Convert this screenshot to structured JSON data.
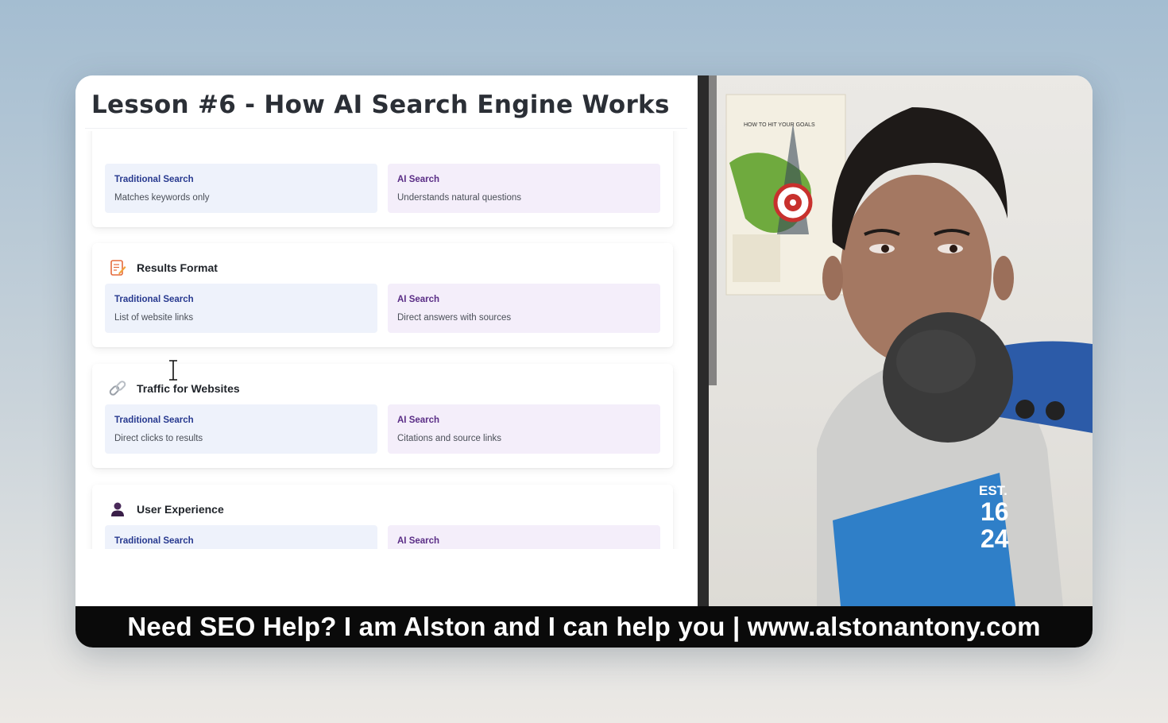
{
  "lesson": {
    "title": "Lesson #6 - How AI Search Engine Works"
  },
  "comparisons": [
    {
      "title": "",
      "icon": "none",
      "traditional": {
        "label": "Traditional Search",
        "desc": "Matches keywords only"
      },
      "ai": {
        "label": "AI Search",
        "desc": "Understands natural questions"
      }
    },
    {
      "title": "Results Format",
      "icon": "memo-icon",
      "traditional": {
        "label": "Traditional Search",
        "desc": "List of website links"
      },
      "ai": {
        "label": "AI Search",
        "desc": "Direct answers with sources"
      }
    },
    {
      "title": "Traffic for Websites",
      "icon": "link-icon",
      "traditional": {
        "label": "Traditional Search",
        "desc": "Direct clicks to results"
      },
      "ai": {
        "label": "AI Search",
        "desc": "Citations and source links"
      }
    },
    {
      "title": "User Experience",
      "icon": "user-icon",
      "traditional": {
        "label": "Traditional Search",
        "desc": ""
      },
      "ai": {
        "label": "AI Search",
        "desc": ""
      }
    }
  ],
  "webcam": {
    "poster_heading": "HOW TO HIT YOUR GOALS",
    "shirt_text": [
      "EST.",
      "16",
      "24"
    ]
  },
  "banner": {
    "text": "Need SEO Help? I am Alston and I can help you | www.alstonantony.com"
  },
  "colors": {
    "traditional_bg": "#eef2fb",
    "ai_bg": "#f4eefa",
    "traditional_label": "#27398f",
    "ai_label": "#5a2d86",
    "banner_bg": "#0a0a0a"
  }
}
